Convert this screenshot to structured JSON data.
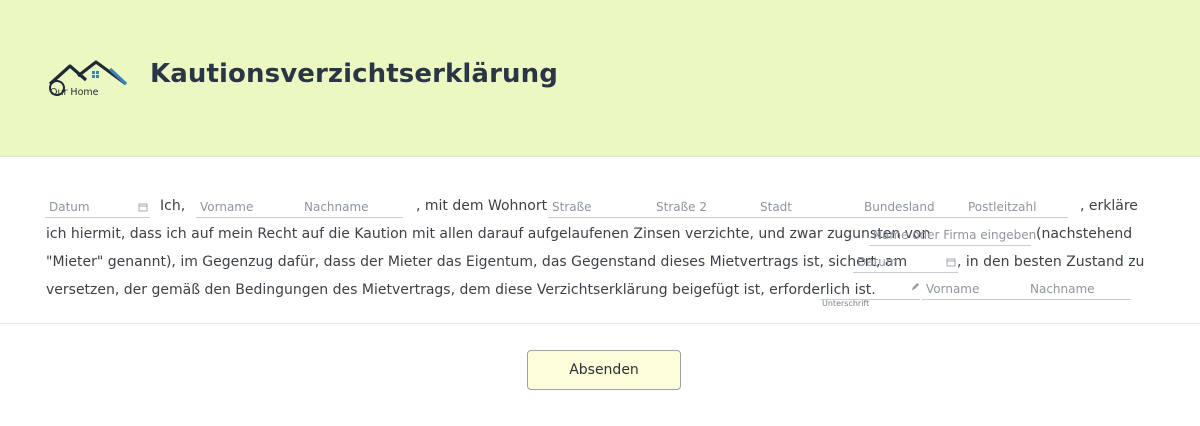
{
  "header": {
    "logo_text": "Our Home",
    "title": "Kautionsverzichtserklärung"
  },
  "form": {
    "date1_placeholder": "Datum",
    "ich": "Ich,",
    "first_name_placeholder": "Vorname",
    "last_name_placeholder": "Nachname",
    "wohnort_text": ", mit dem Wohnort",
    "street_placeholder": "Straße",
    "street2_placeholder": "Straße 2",
    "city_placeholder": "Stadt",
    "state_placeholder": "Bundesland",
    "zip_placeholder": "Postleitzahl",
    "erklaere_text": ", erkläre",
    "line2_text": "ich hiermit, dass ich auf mein Recht auf die Kaution mit allen darauf aufgelaufenen Zinsen verzichte, und zwar zugunsten von",
    "beneficiary_placeholder": "Name oder Firma eingeben",
    "nachstehend_text": "(nachstehend",
    "line3_text": "\"Mieter\" genannt), im Gegenzug dafür, dass der Mieter das Eigentum, das Gegenstand dieses Mietvertrags ist, sichert, am",
    "date2_placeholder": "Datum",
    "line3_end_text": ",  in den besten Zustand zu",
    "line4_text": "versetzen, der gemäß den Bedingungen des Mietvertrags, dem diese Verzichtserklärung beigefügt ist, erforderlich ist.",
    "signature_label": "Unterschrift",
    "sig_first_name_placeholder": "Vorname",
    "sig_last_name_placeholder": "Nachname"
  },
  "submit_label": "Absenden",
  "colors": {
    "header_bg": "#ecf8c1",
    "button_bg": "#fefdd9",
    "title": "#2a3545"
  },
  "icons": [
    "house-logo-icon",
    "calendar-icon",
    "pen-icon"
  ]
}
